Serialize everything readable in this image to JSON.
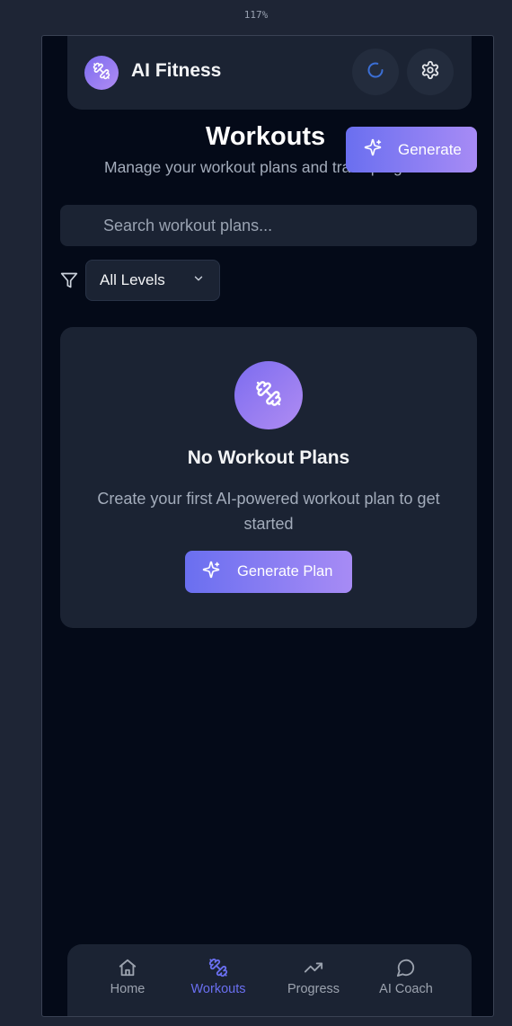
{
  "browser": {
    "zoom": "117%"
  },
  "header": {
    "app_title": "AI Fitness",
    "logo_icon": "dumbbell-icon",
    "refresh_icon": "loading-spinner-icon",
    "settings_icon": "gear-icon"
  },
  "page": {
    "title": "Workouts",
    "subtitle": "Manage your workout plans and track progress",
    "generate_label": "Generate"
  },
  "search": {
    "placeholder": "Search workout plans..."
  },
  "filter": {
    "selected": "All Levels",
    "icon": "funnel-icon"
  },
  "empty_state": {
    "icon": "dumbbell-icon",
    "title": "No Workout Plans",
    "description": "Create your first AI-powered workout plan to get started",
    "button_label": "Generate Plan"
  },
  "nav": {
    "items": [
      {
        "label": "Home",
        "icon": "home-icon"
      },
      {
        "label": "Workouts",
        "icon": "dumbbell-icon"
      },
      {
        "label": "Progress",
        "icon": "trending-up-icon"
      },
      {
        "label": "AI Coach",
        "icon": "chat-bubble-icon"
      }
    ],
    "active_index": 1
  },
  "colors": {
    "accent_start": "#6a6ff0",
    "accent_end": "#a78bf5",
    "background": "#040a18",
    "card": "#1b2333"
  }
}
